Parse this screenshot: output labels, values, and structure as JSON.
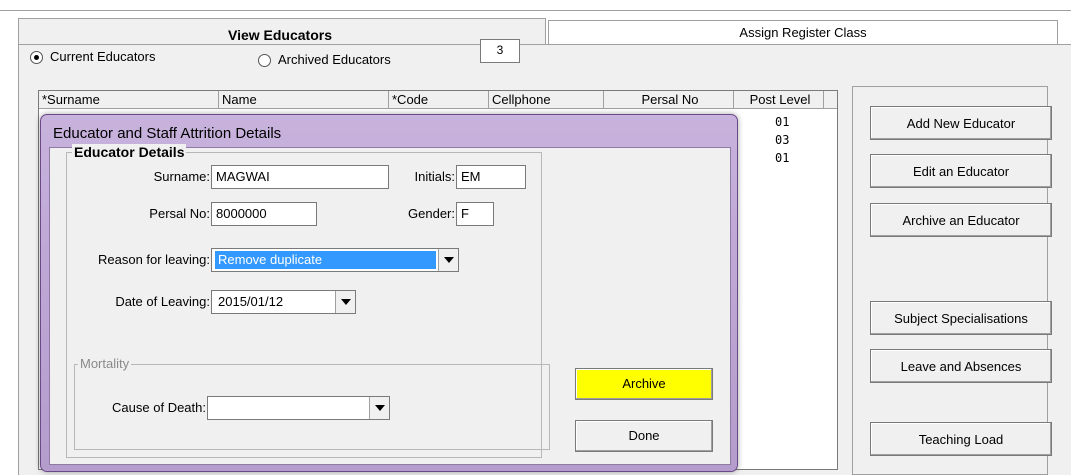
{
  "header": {
    "title": "View Educators",
    "assign_tab": "Assign Register Class",
    "radio_current": "Current Educators",
    "radio_archived": "Archived Educators",
    "count": "3"
  },
  "grid": {
    "columns": [
      "*Surname",
      "Name",
      "*Code",
      "Cellphone",
      "Persal No",
      "Post Level"
    ],
    "post_levels": [
      "01",
      "03",
      "01"
    ]
  },
  "actions": {
    "add": "Add New Educator",
    "edit": "Edit an Educator",
    "archive": "Archive an Educator",
    "subjects": "Subject Specialisations",
    "leave": "Leave and Absences",
    "teaching": "Teaching Load"
  },
  "dialog": {
    "title": "Educator and Staff Attrition Details",
    "group_title": "Educator Details",
    "surname_label": "Surname:",
    "surname_value": "MAGWAI",
    "initials_label": "Initials:",
    "initials_value": "EM",
    "persal_label": "Persal No:",
    "persal_value": "8000000",
    "gender_label": "Gender:",
    "gender_value": "F",
    "reason_label": "Reason for leaving:",
    "reason_value": "Remove duplicate",
    "date_label": "Date of Leaving:",
    "date_value": "2015/01/12",
    "mortality_title": "Mortality",
    "cause_label": "Cause of Death:",
    "cause_value": "",
    "archive_btn": "Archive",
    "done_btn": "Done"
  },
  "colors": {
    "dialog_frame": "#bfa7d6",
    "archive_button": "#ffff00",
    "selection": "#3399ff"
  }
}
